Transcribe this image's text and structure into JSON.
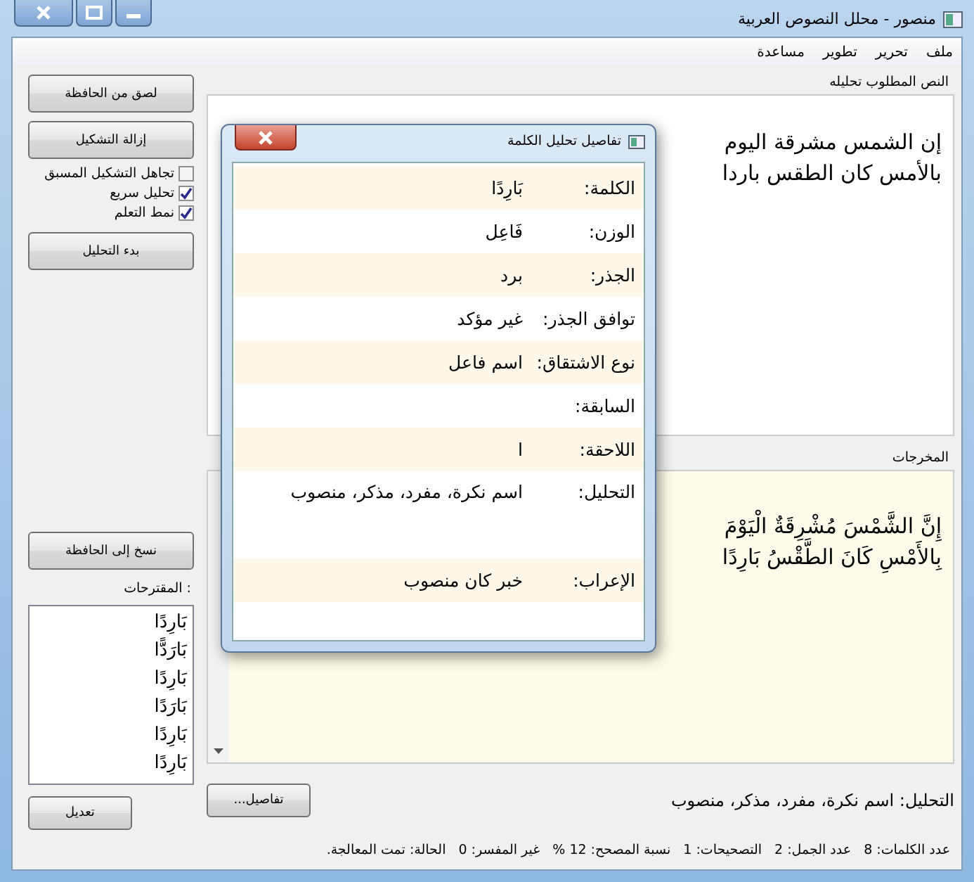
{
  "window": {
    "title": "منصور - محلل النصوص العربية"
  },
  "menu": [
    "ملف",
    "تحرير",
    "تطوير",
    "مساعدة"
  ],
  "sidebar": {
    "top_buttons": [
      "لصق من الحافظة",
      "إزالة التشكيل"
    ],
    "checkboxes": [
      {
        "label": "تجاهل التشكيل المسبق",
        "checked": false
      },
      {
        "label": "تحليل سريع",
        "checked": true
      },
      {
        "label": "نمط التعلم",
        "checked": true
      }
    ],
    "analyze_button": "بدء التحليل",
    "copy_button": "نسخ إلى الحافظة",
    "suggestions_label": "المقترحات :",
    "suggestions": [
      "بَارِدًا",
      "بَارَدًّا",
      "بَارِدًا",
      "بَارَدًا",
      "بَارِدًا",
      "بَارِدًا"
    ],
    "edit_button": "تعديل"
  },
  "input": {
    "label": "النص المطلوب تحليله",
    "lines": [
      "إن الشمس مشرقة اليوم",
      "بالأمس كان الطقس باردا"
    ]
  },
  "output": {
    "label": "المخرجات",
    "lines": [
      "إِنَّ الشَّمْسَ مُشْرِقَةٌ الْيَوْمَ",
      "بِالأَمْسِ كَانَ الطَّقْسُ بَارِدًا"
    ]
  },
  "analysis": "التحليل: اسم نكرة، مفرد، مذكر، منصوب",
  "details_button": "تفاصيل...",
  "status_bar": [
    "عدد الكلمات: 8",
    "عدد الجمل: 2",
    "التصحيحات: 1",
    "نسبة المصحح: 12 %",
    "غير المفسر: 0",
    "الحالة: تمت المعالجة."
  ],
  "dialog": {
    "title": "تفاصيل تحليل الكلمة",
    "rows": [
      {
        "label": "الكلمة:",
        "value": "بَارِدًا"
      },
      {
        "label": "الوزن:",
        "value": "فَاعِل"
      },
      {
        "label": "الجذر:",
        "value": "برد"
      },
      {
        "label": "توافق الجذر:",
        "value": "غير مؤكد"
      },
      {
        "label": "نوع الاشتقاق:",
        "value": "اسم فاعل"
      },
      {
        "label": "السابقة:"
      },
      {
        "label": "اللاحقة:",
        "value": "ا"
      },
      {
        "label": "التحليل:",
        "value": "اسم نكرة، مفرد، مذكر، منصوب",
        "tall": true
      },
      {
        "label": "الإعراب:",
        "value": "خبر كان منصوب"
      }
    ]
  }
}
